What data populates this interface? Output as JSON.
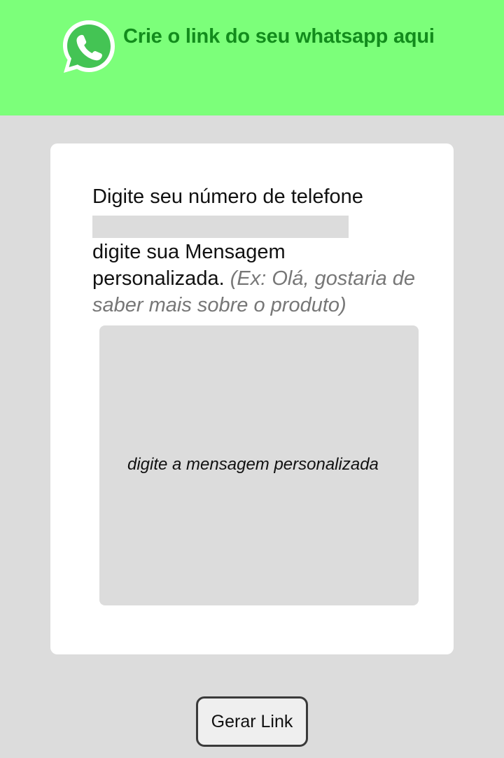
{
  "header": {
    "title": "Crie o link do seu whatsapp aqui",
    "logo_icon": "whatsapp-logo-icon",
    "background_color": "#7cff7a",
    "title_color": "#128c1c"
  },
  "form": {
    "phone_label": "Digite seu número de telefone",
    "phone_value": "",
    "message_label": "digite sua Mensagem personalizada.",
    "message_example": "(Ex: Olá, gostaria de saber mais sobre o produto)",
    "message_placeholder": "digite a mensagem personalizada"
  },
  "actions": {
    "generate_label": "Gerar Link"
  }
}
